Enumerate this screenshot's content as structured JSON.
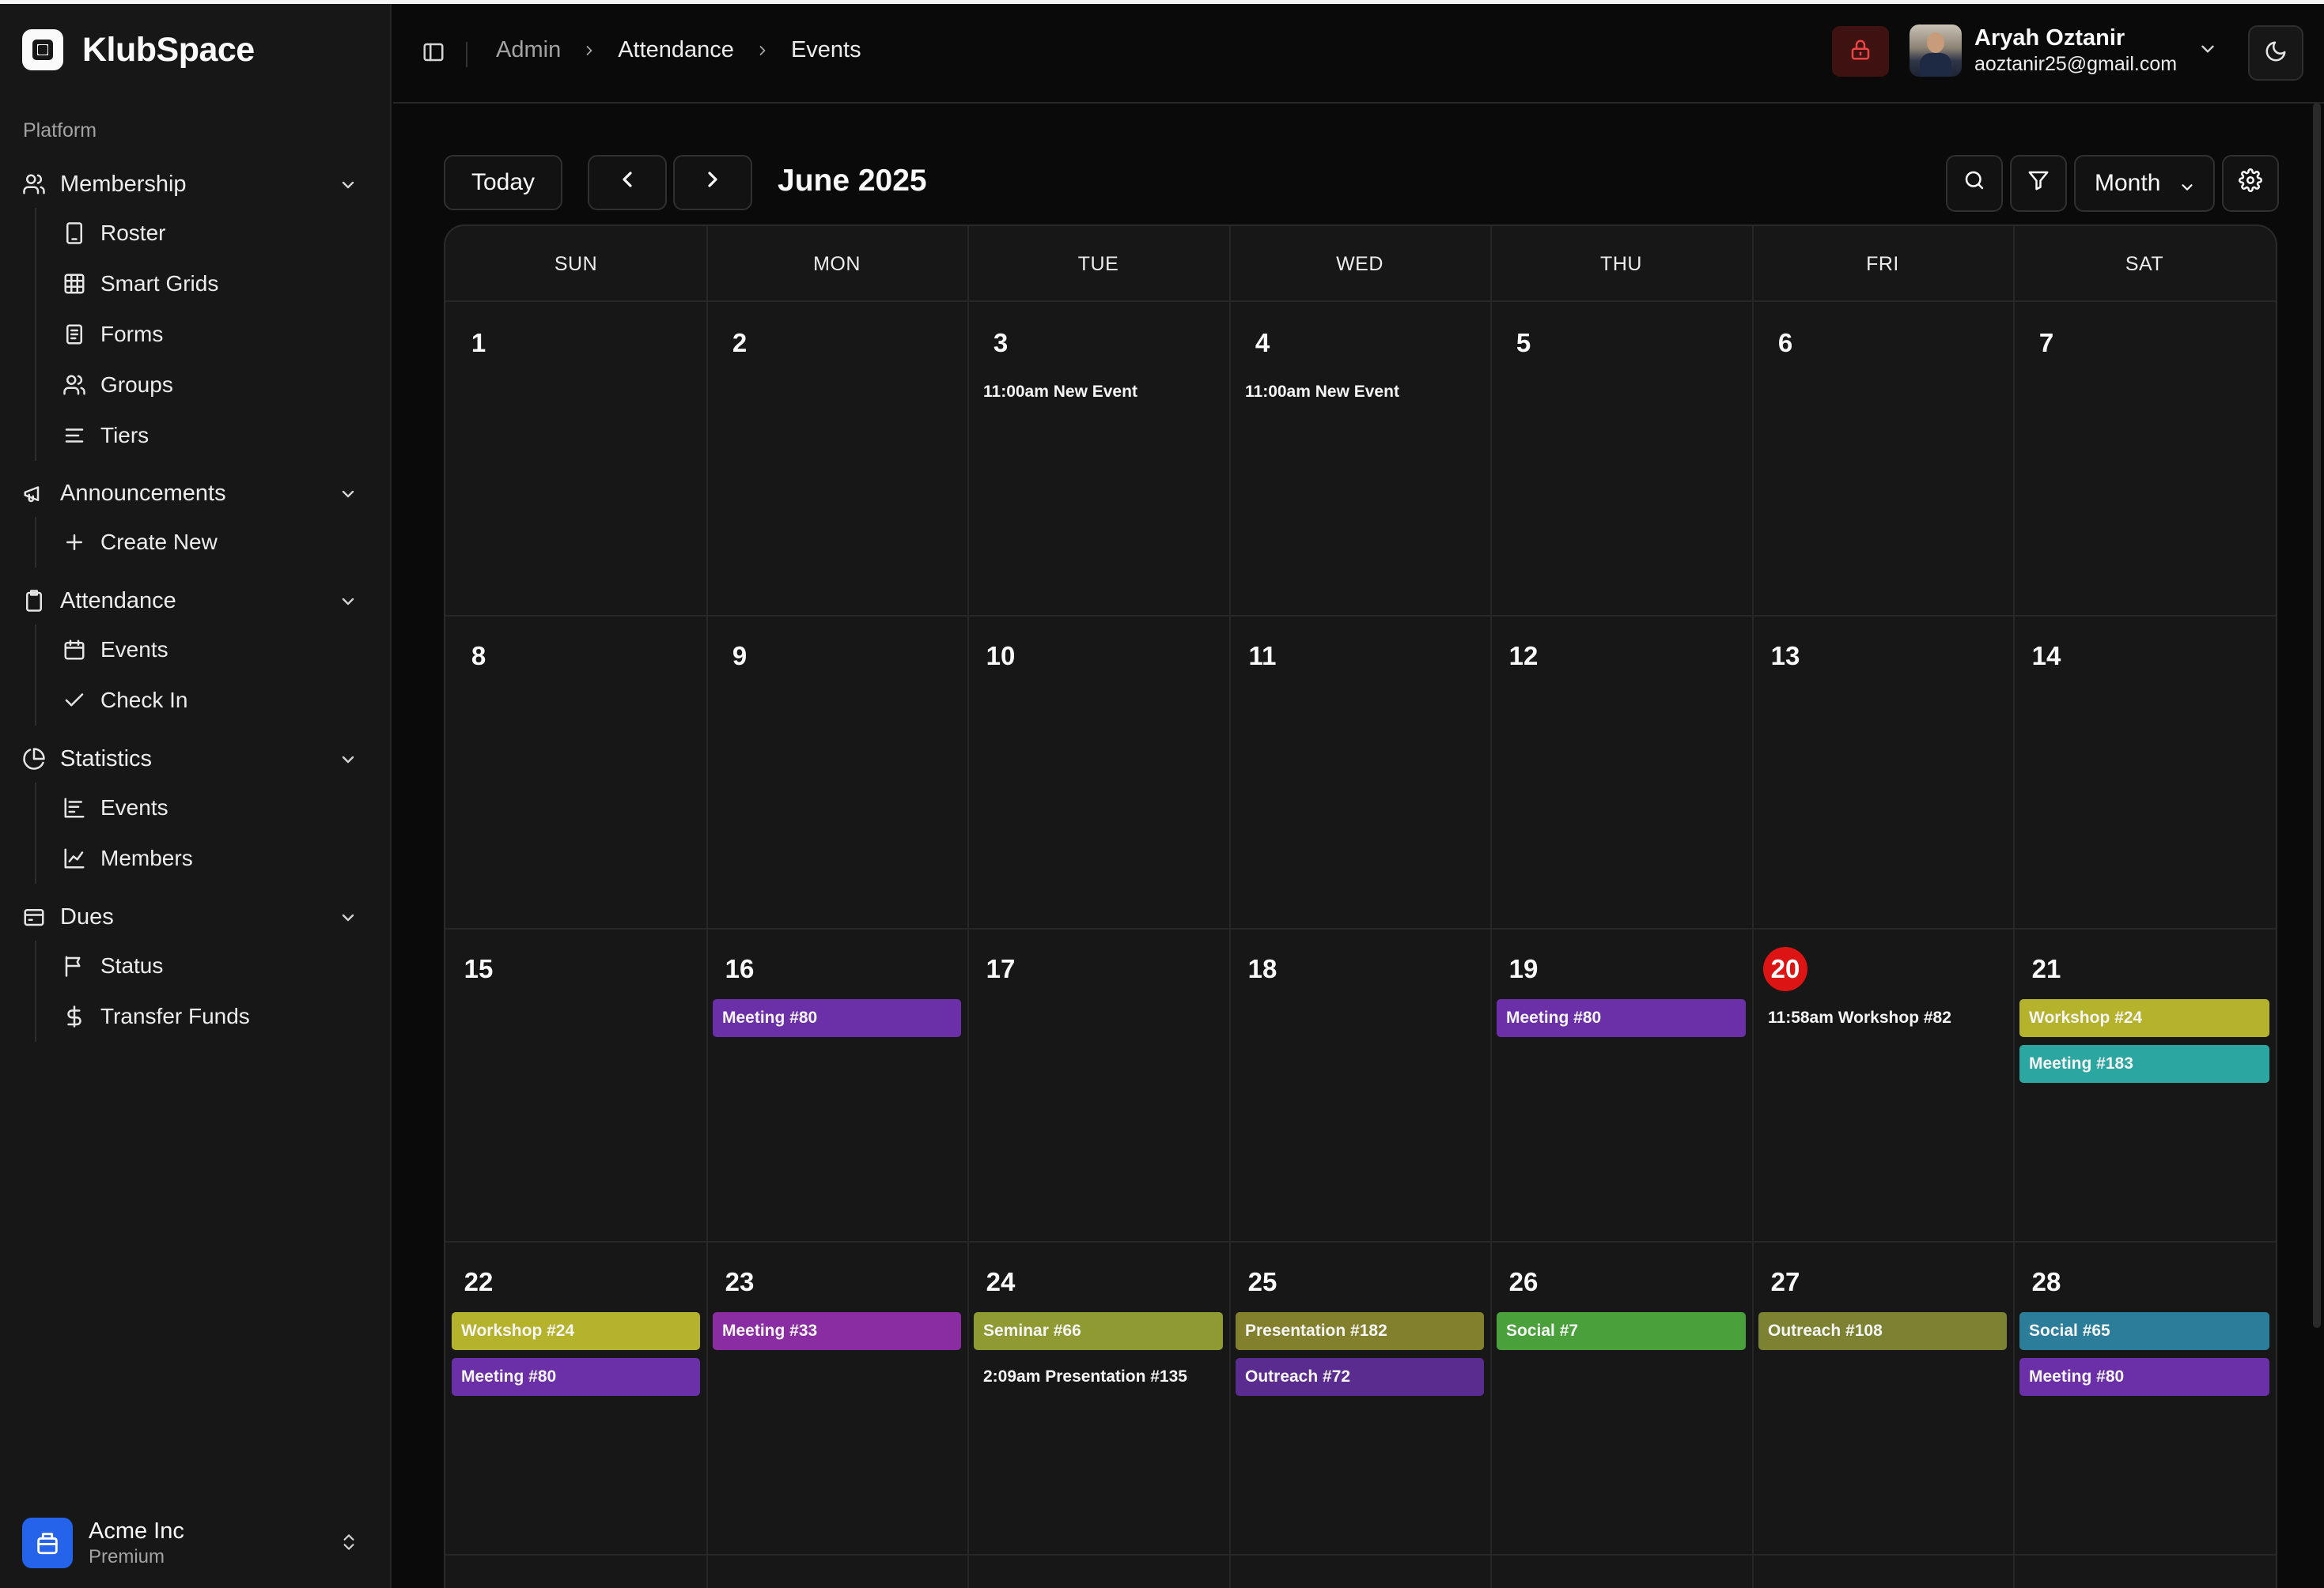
{
  "app": {
    "name": "KlubSpace"
  },
  "sidebar": {
    "section_label": "Platform",
    "groups": [
      {
        "label": "Membership",
        "icon": "users-icon",
        "items": [
          {
            "label": "Roster",
            "icon": "tablet-icon"
          },
          {
            "label": "Smart Grids",
            "icon": "grid-icon"
          },
          {
            "label": "Forms",
            "icon": "form-icon"
          },
          {
            "label": "Groups",
            "icon": "users-icon"
          },
          {
            "label": "Tiers",
            "icon": "lines-icon"
          }
        ]
      },
      {
        "label": "Announcements",
        "icon": "megaphone-icon",
        "items": [
          {
            "label": "Create New",
            "icon": "plus-icon"
          }
        ]
      },
      {
        "label": "Attendance",
        "icon": "clipboard-icon",
        "items": [
          {
            "label": "Events",
            "icon": "calendar-icon"
          },
          {
            "label": "Check In",
            "icon": "check-icon"
          }
        ]
      },
      {
        "label": "Statistics",
        "icon": "pie-chart-icon",
        "items": [
          {
            "label": "Events",
            "icon": "bar-chart-icon"
          },
          {
            "label": "Members",
            "icon": "line-chart-icon"
          }
        ]
      },
      {
        "label": "Dues",
        "icon": "wallet-icon",
        "items": [
          {
            "label": "Status",
            "icon": "flag-icon"
          },
          {
            "label": "Transfer Funds",
            "icon": "dollar-icon"
          }
        ]
      }
    ],
    "org": {
      "name": "Acme Inc",
      "plan": "Premium"
    }
  },
  "header": {
    "breadcrumbs": [
      "Admin",
      "Attendance",
      "Events"
    ],
    "user": {
      "name": "Aryah Oztanir",
      "email": "aoztanir25@gmail.com"
    }
  },
  "toolbar": {
    "today_label": "Today",
    "month_title": "June 2025",
    "view_label": "Month"
  },
  "calendar": {
    "weekdays": [
      "SUN",
      "MON",
      "TUE",
      "WED",
      "THU",
      "FRI",
      "SAT"
    ],
    "today": 20,
    "weeks": [
      [
        {
          "day": 1,
          "events": []
        },
        {
          "day": 2,
          "events": []
        },
        {
          "day": 3,
          "events": [
            {
              "text": "11:00am New Event",
              "color": null
            }
          ]
        },
        {
          "day": 4,
          "events": [
            {
              "text": "11:00am New Event",
              "color": null
            }
          ]
        },
        {
          "day": 5,
          "events": []
        },
        {
          "day": 6,
          "events": []
        },
        {
          "day": 7,
          "events": []
        }
      ],
      [
        {
          "day": 8,
          "events": []
        },
        {
          "day": 9,
          "events": []
        },
        {
          "day": 10,
          "events": []
        },
        {
          "day": 11,
          "events": []
        },
        {
          "day": 12,
          "events": []
        },
        {
          "day": 13,
          "events": []
        },
        {
          "day": 14,
          "events": []
        }
      ],
      [
        {
          "day": 15,
          "events": []
        },
        {
          "day": 16,
          "events": [
            {
              "text": "Meeting #80",
              "color": "#6b2fa8"
            }
          ]
        },
        {
          "day": 17,
          "events": []
        },
        {
          "day": 18,
          "events": []
        },
        {
          "day": 19,
          "events": [
            {
              "text": "Meeting #80",
              "color": "#6b2fa8"
            }
          ]
        },
        {
          "day": 20,
          "events": [
            {
              "text": "11:58am Workshop #82",
              "color": null
            }
          ]
        },
        {
          "day": 21,
          "events": [
            {
              "text": "Workshop #24",
              "color": "#b5b22c"
            },
            {
              "text": "Meeting #183",
              "color": "#2ca6a0"
            }
          ]
        }
      ],
      [
        {
          "day": 22,
          "events": [
            {
              "text": "Workshop #24",
              "color": "#b5b22c"
            },
            {
              "text": "Meeting #80",
              "color": "#6b2fa8"
            }
          ]
        },
        {
          "day": 23,
          "events": [
            {
              "text": "Meeting #33",
              "color": "#8a2da3"
            }
          ]
        },
        {
          "day": 24,
          "events": [
            {
              "text": "Seminar #66",
              "color": "#8f9a33"
            },
            {
              "text": "2:09am Presentation #135",
              "color": null
            }
          ]
        },
        {
          "day": 25,
          "events": [
            {
              "text": "Presentation #182",
              "color": "#83802d"
            },
            {
              "text": "Outreach #72",
              "color": "#5b2c8f"
            }
          ]
        },
        {
          "day": 26,
          "events": [
            {
              "text": "Social #7",
              "color": "#4aa03a"
            }
          ]
        },
        {
          "day": 27,
          "events": [
            {
              "text": "Outreach #108",
              "color": "#7d8232"
            }
          ]
        },
        {
          "day": 28,
          "events": [
            {
              "text": "Social #65",
              "color": "#2c7d9a"
            },
            {
              "text": "Meeting #80",
              "color": "#6b2fa8"
            }
          ]
        }
      ]
    ]
  }
}
